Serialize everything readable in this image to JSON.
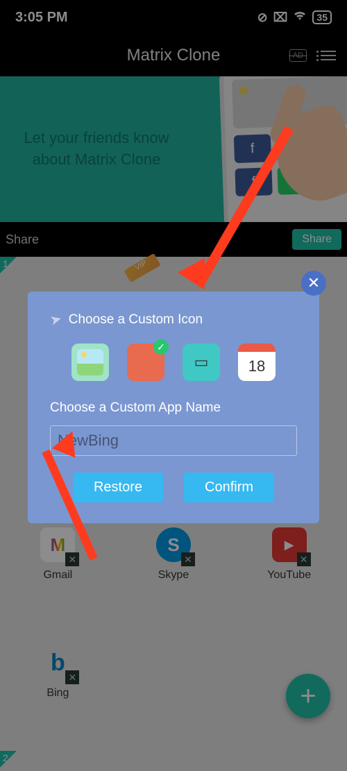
{
  "status": {
    "time": "3:05 PM",
    "battery": "35"
  },
  "appbar": {
    "title": "Matrix Clone"
  },
  "banner": {
    "line1": "Let your friends know",
    "line2": "about Matrix Clone"
  },
  "share": {
    "label": "Share",
    "button": "Share"
  },
  "tags": {
    "one": "1",
    "two": "2",
    "vip": "VIP"
  },
  "apps": {
    "gmail": "Gmail",
    "skype": "Skype",
    "youtube": "YouTube",
    "bing": "Bing"
  },
  "dialog": {
    "title": "Choose a Custom Icon",
    "subtitle": "Choose a Custom App Name",
    "input_value": "NewBing",
    "calendar_num": "18",
    "restore": "Restore",
    "confirm": "Confirm"
  }
}
